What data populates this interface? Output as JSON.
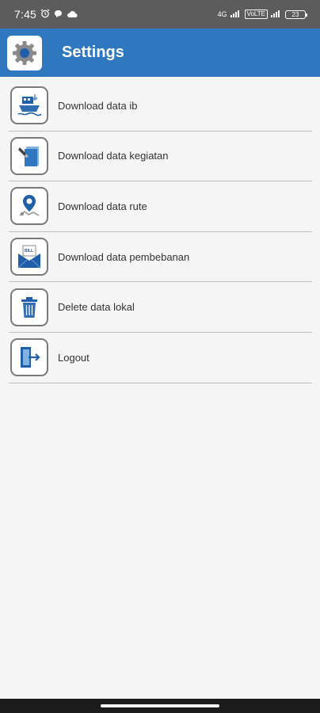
{
  "status_bar": {
    "time": "7:45",
    "sim_label": "4G",
    "sim2_label": "VoLTE",
    "battery_level": "23"
  },
  "app_bar": {
    "title": "Settings",
    "logo_icon": "gear-icon"
  },
  "menu": {
    "items": [
      {
        "label": "Download data ib",
        "icon": "ship-download-icon"
      },
      {
        "label": "Download data kegiatan",
        "icon": "activity-document-icon"
      },
      {
        "label": "Download data rute",
        "icon": "map-pin-route-icon"
      },
      {
        "label": "Download data pembebanan",
        "icon": "bill-envelope-icon"
      },
      {
        "label": "Delete data lokal",
        "icon": "trash-icon"
      },
      {
        "label": "Logout",
        "icon": "logout-door-icon"
      }
    ]
  },
  "colors": {
    "app_bar": "#2f78bf",
    "status_bar": "#5c5c5c",
    "icon_blue": "#1f5ea8",
    "background": "#f5f5f5"
  }
}
